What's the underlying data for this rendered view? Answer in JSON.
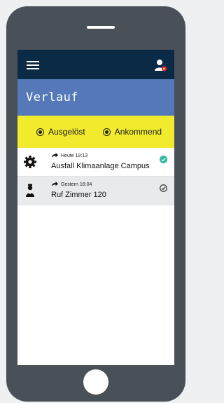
{
  "header": {
    "menu_icon": "hamburger-menu-icon",
    "user_icon": "user-icon"
  },
  "page": {
    "title": "Verlauf"
  },
  "filters": [
    {
      "label": "Ausgelöst",
      "selected": true
    },
    {
      "label": "Ankommend",
      "selected": true
    }
  ],
  "history": [
    {
      "icon": "gear-icon",
      "time": "Heute 19:13",
      "subject": "Ausfall Klimaanlage Campus",
      "status": "confirmed",
      "status_color": "#2fb7a0"
    },
    {
      "icon": "person-icon",
      "time": "Gestern 16:04",
      "subject": "Ruf Zimmer 120",
      "status": "done",
      "status_color": "#222222"
    }
  ],
  "colors": {
    "appbar": "#0b2a45",
    "title_band": "#5579b8",
    "filter_band": "#f1ea2d",
    "alert_dot": "#e1322d"
  }
}
